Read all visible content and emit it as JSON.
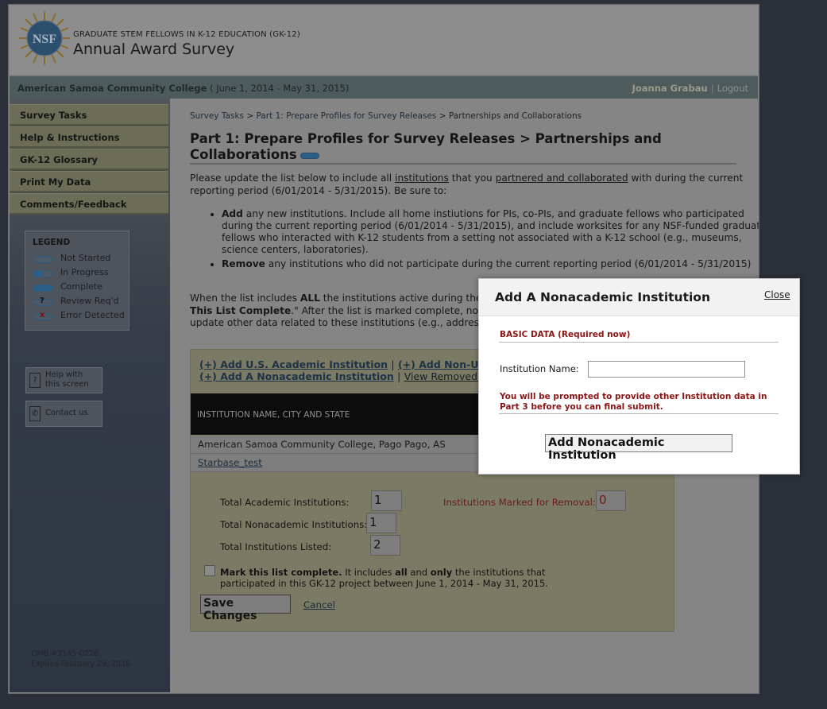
{
  "header": {
    "logo_text": "NSF",
    "program": "GRADUATE STEM FELLOWS IN K-12 EDUCATION (GK-12)",
    "title": "Annual Award Survey"
  },
  "statusbar": {
    "institution": "American Samoa Community College",
    "period": " ( June 1, 2014 - May 31, 2015)",
    "user": "Joanna Grabau",
    "separator": "|",
    "logout": "Logout"
  },
  "sidebar": {
    "items": [
      {
        "label": "Survey Tasks"
      },
      {
        "label": "Help & Instructions"
      },
      {
        "label": "GK-12 Glossary"
      },
      {
        "label": "Print My Data"
      },
      {
        "label": "Comments/Feedback"
      }
    ],
    "legend": {
      "title": "LEGEND",
      "items": [
        "Not Started",
        "In Progress",
        "Complete",
        "Review Req'd",
        "Error Detected"
      ],
      "review_mark": "?",
      "error_mark": "x"
    },
    "help_button": {
      "icon_glyph": "?",
      "line1": "Help with",
      "line2": "this screen"
    },
    "contact_button": {
      "icon_glyph": "✆",
      "label": "Contact us"
    },
    "omb_line1": "OMB #3145-0226",
    "omb_line2": "Expires February 29, 2016"
  },
  "main": {
    "breadcrumb": {
      "item1": "Survey Tasks",
      "sep": ">",
      "item2": "Part 1: Prepare Profiles for Survey Releases",
      "item3": "Partnerships and Collaborations"
    },
    "title": "Part 1: Prepare Profiles for Survey Releases > Partnerships and Collaborations",
    "intro": {
      "p1": "Please update the list below to include all ",
      "link1": "institutions",
      "p2": " that you ",
      "link2": "partnered and collaborated",
      "p3": " with during the current reporting period (6/01/2014 - 5/31/2015). Be sure to:"
    },
    "bullets": [
      {
        "bold": "Add",
        "text": " any new institutions. Include all home instiutions for PIs, co-PIs, and graduate fellows who participated during the current reporting period (6/01/2014 - 5/31/2015), and include worksites for any NSF-funded graduate fellows who interacted with K-12 students from a setting not associated with a K-12 school (e.g., museums, science centers, laboratories)."
      },
      {
        "bold": "Remove",
        "text": " any institutions who did not participate during the current reporting period (6/01/2014 - 5/31/2015)"
      }
    ],
    "when": {
      "t1": "When the list includes ",
      "b1": "ALL",
      "t2": " the institutions active during the",
      "b2": "This List Complete",
      "t3": ".\" After the list is marked complete, no r",
      "t4": "update other data related to these institutions (e.g., address)."
    },
    "add_links": {
      "us_academic": "(+) Add U.S. Academic Institution",
      "sep": "|",
      "non_us": "(+) Add Non-U.S.",
      "nonacademic": "(+) Add A Nonacademic Institution",
      "view_removed": "View Removed In"
    },
    "table": {
      "header": "INSTITUTION NAME, CITY AND STATE",
      "rows": [
        "American Samoa Community College, Pago Pago, AS",
        "Starbase_test"
      ]
    },
    "totals": {
      "academic_label": "Total Academic Institutions:",
      "academic_value": "1",
      "nonacademic_label": "Total Nonacademic Institutions:",
      "nonacademic_value": "1",
      "listed_label": "Total Institutions Listed:",
      "listed_value": "2",
      "removal_label": "Institutions Marked for Removal:",
      "removal_value": "0"
    },
    "mark_complete": {
      "bold1": "Mark this list complete.",
      "t1": " It includes ",
      "b2": "all",
      "t2": " and ",
      "b3": "only",
      "t3": " the institutions that participated in this GK-12 project between June 1, 2014 - May 31, 2015."
    },
    "save_label": "Save Changes",
    "cancel_label": "Cancel"
  },
  "modal": {
    "title": "Add A Nonacademic Institution",
    "close": "Close",
    "section": "BASIC DATA (Required now)",
    "name_label": "Institution Name:",
    "name_value": "",
    "note": "You will be prompted to provide other Institution data in Part 3 before you can final submit.",
    "submit": "Add Nonacademic Institution"
  },
  "colors": {
    "page_bg": "#2b2f3a",
    "dimmed_panel": "#858585",
    "modal_bg": "#ffffff",
    "error_text": "#8a1515",
    "status_blue": "#2c5f88"
  }
}
